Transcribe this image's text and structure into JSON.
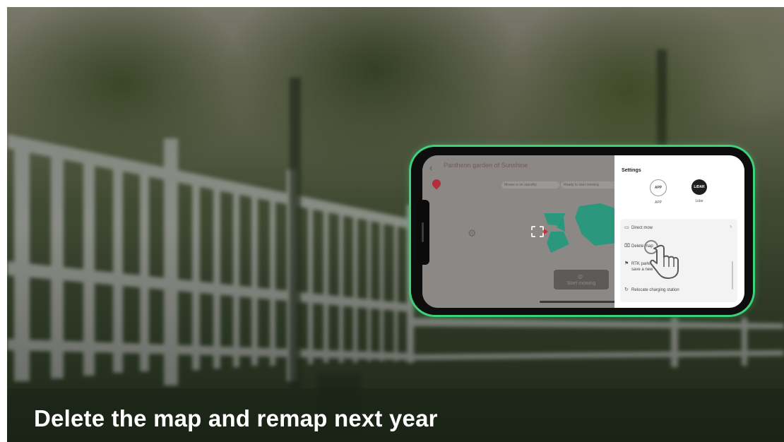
{
  "caption": "Delete the map and remap next year",
  "app": {
    "title": "Pantheon garden of Sunshine",
    "back_icon": "chevron-left-icon",
    "pill_1": "Mower is on standby",
    "pill_2": "Ready to start mowing"
  },
  "start_button": {
    "label": "Start mowing"
  },
  "settings": {
    "title": "Settings",
    "modes": [
      {
        "label": "APP",
        "icon_text": "APP"
      },
      {
        "label": "Lidar",
        "icon_text": "LiDAR"
      }
    ],
    "menu": [
      {
        "label": "Direct mow",
        "icon": "folder-icon"
      },
      {
        "label": "Delete map",
        "icon": "trash-icon"
      },
      {
        "label": "RTK parking spot",
        "label_2": "save a new",
        "icon": "flag-icon"
      },
      {
        "label": "Relocate charging station",
        "icon": "refresh-icon"
      }
    ]
  },
  "colors": {
    "phone_border": "#3fd07a",
    "map_zone": "#1a9a7a",
    "pin": "#b0303a"
  }
}
